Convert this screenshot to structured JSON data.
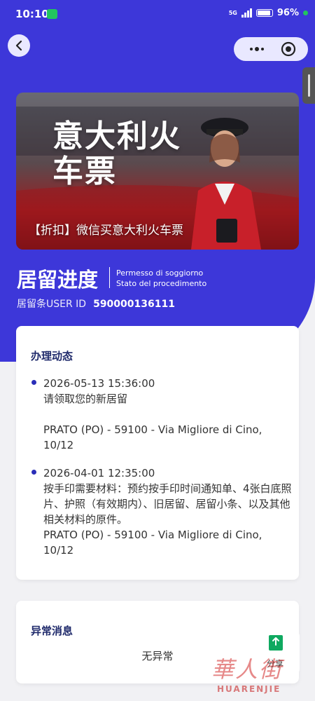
{
  "status_bar": {
    "time": "10:10",
    "network": "5G",
    "battery": "96%"
  },
  "banner": {
    "title": "意大利火车票",
    "caption": "【折扣】微信买意大利火车票"
  },
  "header": {
    "title": "居留进度",
    "subtitle_line1": "Permesso di soggiorno",
    "subtitle_line2": "Stato del procedimento",
    "user_id_label": "居留条USER ID",
    "user_id_value": "590000136111"
  },
  "progress_card": {
    "title": "办理动态",
    "events": [
      {
        "time": "2026-05-13 15:36:00",
        "message": "请领取您的新居留",
        "address": "PRATO (PO) - 59100 - Via Migliore di Cino, 10/12"
      },
      {
        "time": "2026-04-01 12:35:00",
        "message": "按手印需要材料：预约按手印时间通知单、4张白底照片、护照（有效期内）、旧居留、居留小条、以及其他相关材料的原件。",
        "address": "PRATO (PO) - 59100 - Via Migliore di Cino, 10/12"
      }
    ]
  },
  "anomaly_card": {
    "title": "异常消息",
    "text": "无异常"
  },
  "share": {
    "label": "分享"
  },
  "watermark": {
    "main": "華人街",
    "sub": "HUARENJIE"
  },
  "colors": {
    "brand": "#3d37d9",
    "card_title": "#1f2a6b",
    "bullet": "#2a2eb8",
    "share_icon": "#0fa960"
  }
}
